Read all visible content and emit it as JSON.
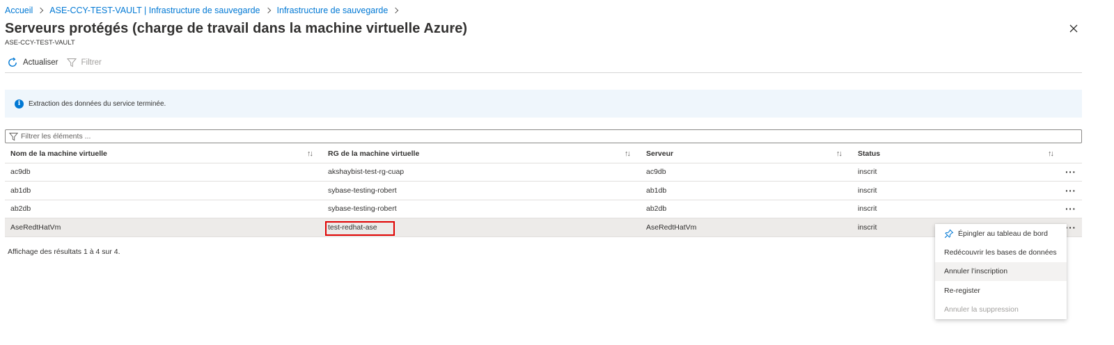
{
  "breadcrumb": {
    "items": [
      "Accueil",
      "ASE-CCY-TEST-VAULT | Infrastructure de sauvegarde",
      "Infrastructure de sauvegarde"
    ]
  },
  "header": {
    "title": "Serveurs protégés (charge de travail dans la machine virtuelle Azure)",
    "more": "···",
    "subtitle": "ASE-CCY-TEST-VAULT"
  },
  "toolbar": {
    "refresh_label": "Actualiser",
    "filter_label": "Filtrer"
  },
  "info": {
    "message": "Extraction des données du service terminée."
  },
  "filter": {
    "placeholder": "Filtrer les éléments ..."
  },
  "table": {
    "columns": [
      "Nom de la machine virtuelle",
      "RG de la machine virtuelle",
      "Serveur",
      "Status"
    ],
    "sort_glyph": "↑↓",
    "more_glyph": "···",
    "rows": [
      {
        "vm": "ac9db",
        "rg": "akshaybist-test-rg-cuap",
        "server": "ac9db",
        "status": "inscrit"
      },
      {
        "vm": "ab1db",
        "rg": "sybase-testing-robert",
        "server": "ab1db",
        "status": "inscrit"
      },
      {
        "vm": "ab2db",
        "rg": "sybase-testing-robert",
        "server": "ab2db",
        "status": "inscrit"
      },
      {
        "vm": "AseRedtHatVm",
        "rg": "test-redhat-ase",
        "server": "AseRedtHatVm",
        "status": "inscrit"
      }
    ],
    "selected_row": 3
  },
  "results": {
    "text": "Affichage des résultats 1 à 4 sur 4."
  },
  "context_menu": {
    "items": [
      {
        "label": "Épingler au tableau de bord",
        "icon": "pin-icon"
      },
      {
        "label": "Redécouvrir les bases de données"
      },
      {
        "label": "Annuler l’inscription",
        "state": "hover"
      },
      {
        "label": "Re-register"
      },
      {
        "label": "Annuler la suppression",
        "state": "disabled"
      }
    ]
  },
  "colors": {
    "link": "#0078d4",
    "info_background": "#eff6fc",
    "selected_row": "#edebe9",
    "highlight_border": "#e00000"
  }
}
